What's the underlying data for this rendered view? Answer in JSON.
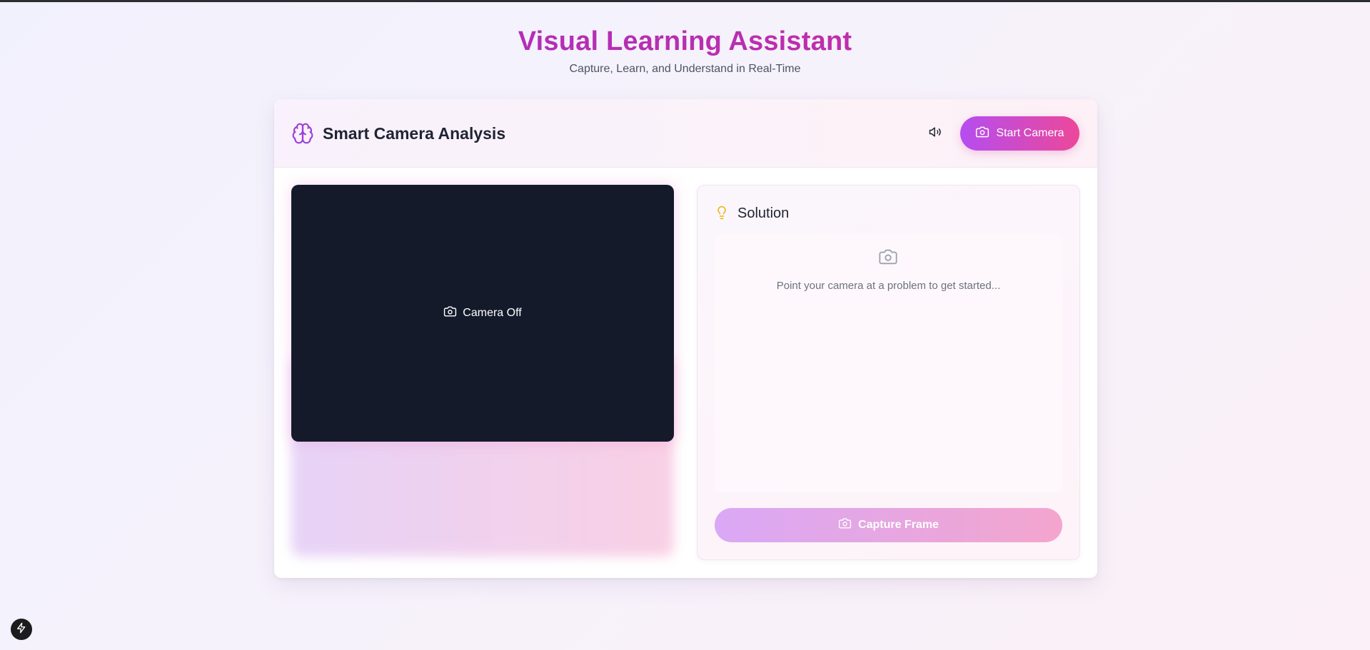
{
  "header": {
    "title": "Visual Learning Assistant",
    "subtitle": "Capture, Learn, and Understand in Real-Time"
  },
  "card": {
    "title": "Smart Camera Analysis",
    "brand_icon": "brain-icon",
    "sound_icon": "volume-icon",
    "start_button_label": "Start Camera",
    "start_button_icon": "camera-icon"
  },
  "camera": {
    "status_label": "Camera Off",
    "status_icon": "camera-icon"
  },
  "solution": {
    "title": "Solution",
    "title_icon": "lightbulb-icon",
    "placeholder": "Point your camera at a problem to get started...",
    "placeholder_icon": "camera-icon",
    "capture_button_label": "Capture Frame"
  },
  "colors": {
    "accent_start": "#b54df0",
    "accent_end": "#ec4899",
    "title_gradient_start": "#a130c9",
    "title_gradient_end": "#d02c99",
    "camera_bg": "#151a2b",
    "bulb": "#eab308"
  },
  "corner_icon": "lightning-icon"
}
